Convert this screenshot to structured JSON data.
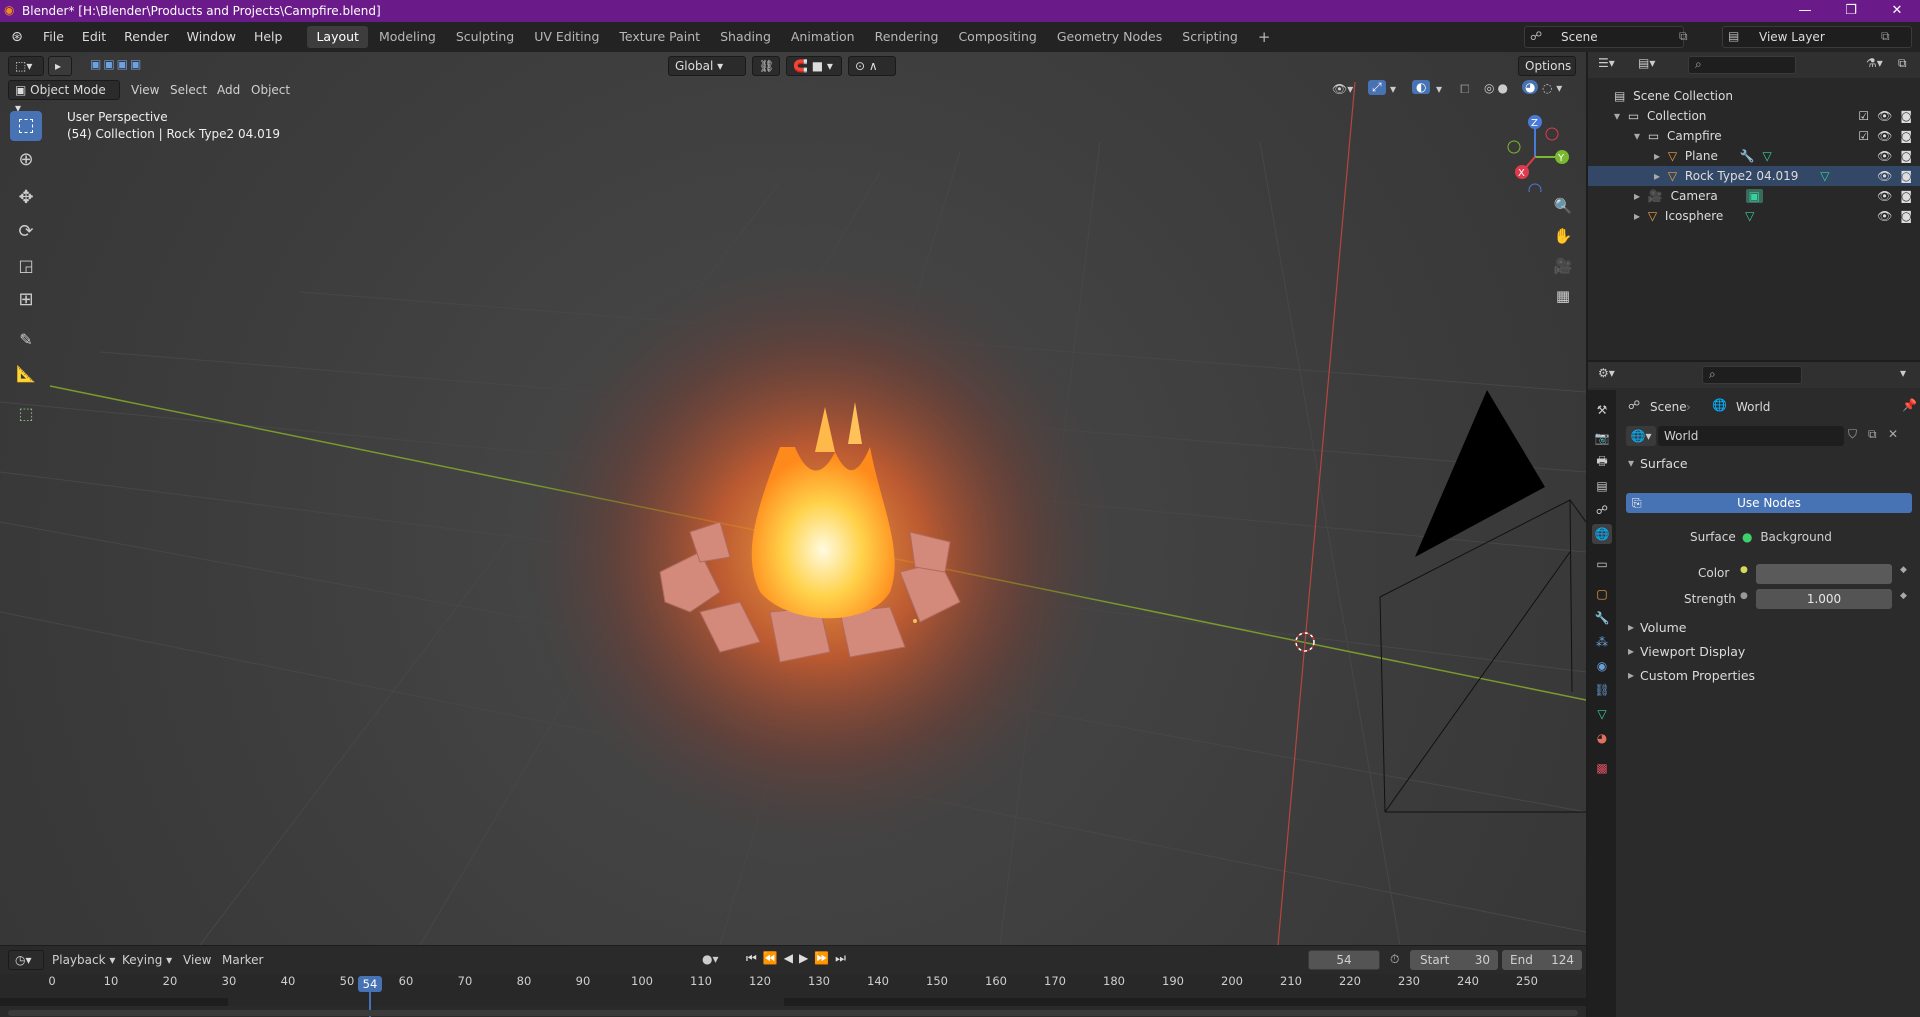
{
  "window": {
    "title": "Blender* [H:\\Blender\\Products and Projects\\Campfire.blend]",
    "controls": [
      "—",
      "❐",
      "✕"
    ]
  },
  "menubar": {
    "menus": [
      "File",
      "Edit",
      "Render",
      "Window",
      "Help"
    ],
    "workspaces": [
      "Layout",
      "Modeling",
      "Sculpting",
      "UV Editing",
      "Texture Paint",
      "Shading",
      "Animation",
      "Rendering",
      "Compositing",
      "Geometry Nodes",
      "Scripting"
    ],
    "active_workspace": "Layout",
    "add_tab": "+",
    "scene": "Scene",
    "view_layer": "View Layer"
  },
  "viewport": {
    "transform_orientation": "Global",
    "options_label": "Options",
    "mode": "Object Mode",
    "menus": [
      "View",
      "Select",
      "Add",
      "Object"
    ],
    "overlay_line1": "User Perspective",
    "overlay_line2": "(54) Collection | Rock Type2 04.019",
    "gizmo_axes": {
      "z": "Z",
      "y": "Y",
      "x": "X"
    }
  },
  "outliner": {
    "items": [
      {
        "label": "Scene Collection"
      },
      {
        "label": "Collection"
      },
      {
        "label": "Campfire"
      },
      {
        "label": "Plane"
      },
      {
        "label": "Rock Type2 04.019"
      },
      {
        "label": "Camera"
      },
      {
        "label": "Icosphere"
      }
    ]
  },
  "properties": {
    "breadcrumb_scene": "Scene",
    "breadcrumb_world": "World",
    "world_name": "World",
    "surface_panel": "Surface",
    "use_nodes": "Use Nodes",
    "surface_label": "Surface",
    "surface_value": "Background",
    "color_label": "Color",
    "strength_label": "Strength",
    "strength_value": "1.000",
    "collapsed_panels": [
      "Volume",
      "Viewport Display",
      "Custom Properties"
    ]
  },
  "timeline": {
    "menus": [
      "Playback",
      "Keying",
      "View",
      "Marker"
    ],
    "current_frame": "54",
    "start_label": "Start",
    "start_value": "30",
    "end_label": "End",
    "end_value": "124",
    "ticks": [
      "0",
      "10",
      "20",
      "30",
      "40",
      "50",
      "60",
      "70",
      "80",
      "90",
      "100",
      "110",
      "120",
      "130",
      "140",
      "150",
      "160",
      "170",
      "180",
      "190",
      "200",
      "210",
      "220",
      "230",
      "240",
      "250"
    ],
    "playhead_label": "54"
  }
}
